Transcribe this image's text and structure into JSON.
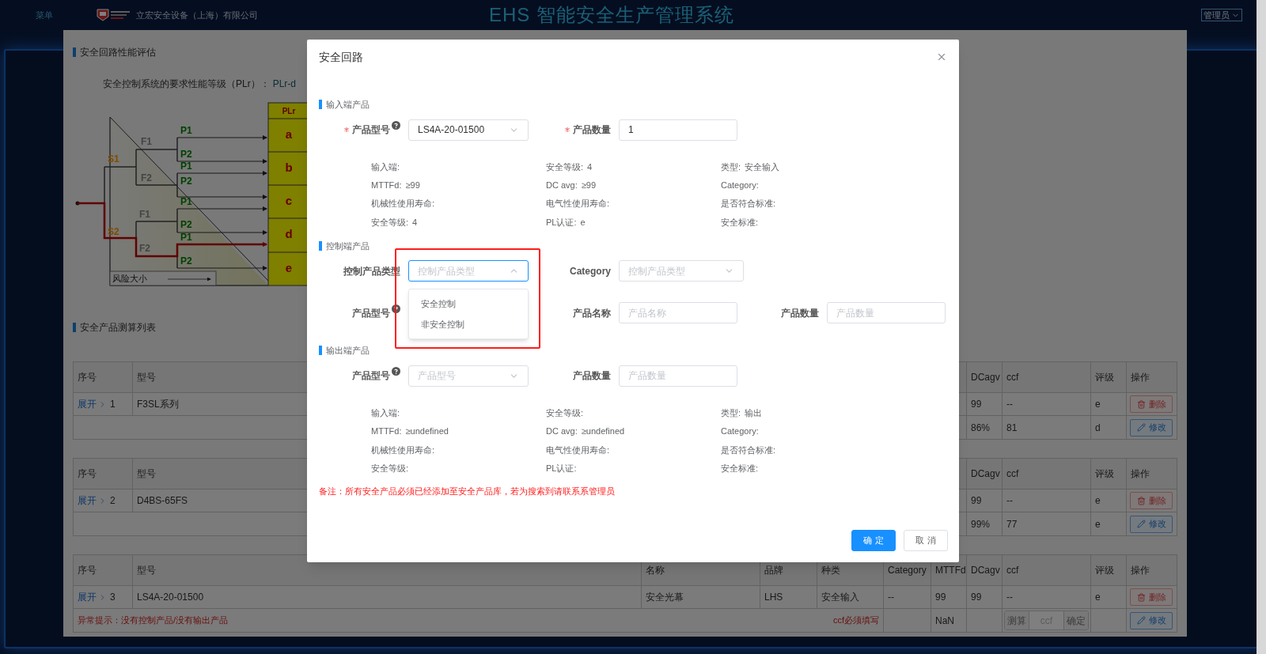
{
  "topbar": {
    "menu": "菜单",
    "company": "立宏安全设备（上海）有限公司",
    "title": "EHS 智能安全生产管理系统",
    "user": "管理员"
  },
  "panel": {
    "evaluation": {
      "title": "安全回路性能评估",
      "requirement_label": "安全控制系统的要求性能等级（PLr）：",
      "requirement_value": "PLr-d"
    },
    "plr_diagram": {
      "header": "PLr",
      "levels": [
        "a",
        "b",
        "c",
        "d",
        "e"
      ],
      "severity": [
        "S1",
        "S2"
      ],
      "frequency": [
        "F1",
        "F2",
        "F1",
        "F2"
      ],
      "possibility": [
        "P1",
        "P2",
        "P1",
        "P2",
        "P1",
        "P2",
        "P1",
        "P2"
      ],
      "risk_label": "风险大小"
    },
    "list_title": "安全产品测算列表",
    "tables": [
      {
        "columns": {
          "index": "序号",
          "model": "型号",
          "dcavg": "DCagv",
          "ccf": "ccf",
          "rating": "评级",
          "actions": "操作"
        },
        "row": {
          "expand": "展开",
          "index": "1",
          "model": "F3SL系列",
          "dcavg": "99",
          "ccf": "--",
          "rating": "e",
          "delete": "删除"
        },
        "sub_row": {
          "dcavg": "86%",
          "ccf": "81",
          "rating": "d",
          "edit": "修改"
        }
      },
      {
        "columns": {
          "index": "序号",
          "model": "型号",
          "dcavg": "DCagv",
          "ccf": "ccf",
          "rating": "评级",
          "actions": "操作"
        },
        "row": {
          "expand": "展开",
          "index": "2",
          "model": "D4BS-65FS",
          "dcavg": "99",
          "ccf": "--",
          "rating": "e",
          "delete": "删除"
        },
        "sub_row": {
          "dcavg": "99%",
          "ccf": "77",
          "rating": "e",
          "edit": "修改"
        }
      },
      {
        "columns": {
          "index": "序号",
          "model": "型号",
          "name": "名称",
          "brand": "品牌",
          "type": "种类",
          "category": "Category",
          "mttfd": "MTTFd",
          "dcavg": "DCagv",
          "ccf": "ccf",
          "rating": "评级",
          "actions": "操作"
        },
        "row": {
          "expand": "展开",
          "index": "3",
          "model": "LS4A-20-01500",
          "name": "安全光幕",
          "brand": "LHS",
          "type": "安全输入",
          "category": "--",
          "mttfd": "99",
          "dcavg": "99",
          "ccf": "--",
          "rating": "e",
          "delete": "删除"
        },
        "sub_row": {
          "warning": "异常提示：没有控制产品/没有输出产品",
          "hint": "ccf必须填写",
          "mttfd": "NaN",
          "ccf_input": {
            "prefix": "测算",
            "placeholder": "ccf",
            "suffix": "确定"
          },
          "edit": "修改"
        }
      }
    ]
  },
  "dialog": {
    "title": "安全回路",
    "sections": [
      {
        "title": "输入端产品",
        "rows": [
          [
            {
              "kind": "select",
              "label": "产品型号",
              "required": true,
              "help": true,
              "value": "LS4A-20-01500",
              "open": false
            },
            {
              "kind": "input",
              "label": "产品数量",
              "required": true,
              "value": "1"
            }
          ]
        ],
        "details": [
          {
            "label": "输入端:"
          },
          {
            "label": "安全等级:",
            "value": "4"
          },
          {
            "label": "类型:",
            "value": "安全输入"
          },
          {
            "label": "MTTFd:",
            "value": "≥99"
          },
          {
            "label": "DC avg:",
            "value": "≥99"
          },
          {
            "label": "Category:"
          },
          {
            "label": "机械性使用寿命:"
          },
          {
            "label": "电气性使用寿命:"
          },
          {
            "label": "是否符合标准:"
          },
          {
            "label": "安全等级:",
            "value": "4"
          },
          {
            "label": "PL认证:",
            "value": "e"
          },
          {
            "label": "安全标准:"
          }
        ]
      },
      {
        "title": "控制端产品",
        "rows": [
          [
            {
              "kind": "select",
              "label": "控制产品类型",
              "placeholder": "控制产品类型",
              "open": true,
              "options": [
                "安全控制",
                "非安全控制"
              ]
            },
            {
              "kind": "select",
              "label": "Category",
              "placeholder": "控制产品类型",
              "open": false
            }
          ],
          [
            {
              "kind": "covered",
              "label": "产品型号",
              "help": true
            },
            {
              "kind": "input",
              "label": "产品名称",
              "placeholder": "产品名称"
            },
            {
              "kind": "input",
              "label": "产品数量",
              "placeholder": "产品数量"
            }
          ]
        ]
      },
      {
        "title": "输出端产品",
        "rows": [
          [
            {
              "kind": "select",
              "label": "产品型号",
              "help": true,
              "placeholder": "产品型号",
              "open": false
            },
            {
              "kind": "input",
              "label": "产品数量",
              "placeholder": "产品数量"
            }
          ]
        ],
        "details": [
          {
            "label": "输入端:"
          },
          {
            "label": "安全等级:"
          },
          {
            "label": "类型:",
            "value": "输出"
          },
          {
            "label": "MTTFd:",
            "value": "≥undefined"
          },
          {
            "label": "DC avg:",
            "value": "≥undefined"
          },
          {
            "label": "Category:"
          },
          {
            "label": "机械性使用寿命:"
          },
          {
            "label": "电气性使用寿命:"
          },
          {
            "label": "是否符合标准:"
          },
          {
            "label": "安全等级:"
          },
          {
            "label": "PL认证:"
          },
          {
            "label": "安全标准:"
          }
        ]
      }
    ],
    "note": "备注：所有安全产品必须已经添加至安全产品库，若为搜索到请联系系管理员",
    "buttons": [
      {
        "label": "确 定",
        "kind": "primary"
      },
      {
        "label": "取 消",
        "kind": "default"
      }
    ]
  }
}
